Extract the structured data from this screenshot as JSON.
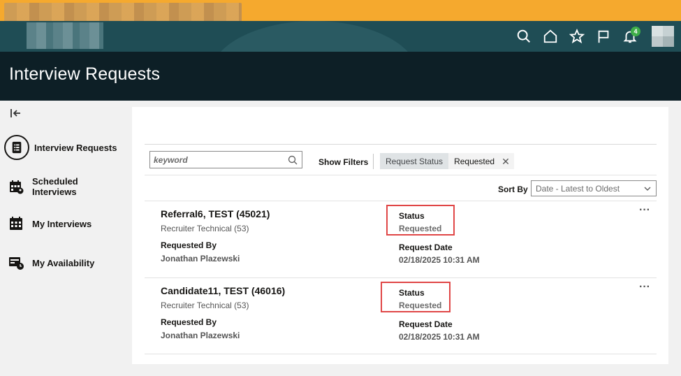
{
  "header": {
    "notification_count": "4",
    "icons": [
      "search-icon",
      "home-icon",
      "star-icon",
      "flag-icon",
      "bell-icon"
    ],
    "colors": {
      "top_strip": "#f5a92e",
      "header_bg": "#1f4d55",
      "title_bg": "#0d1f26",
      "badge": "#3fae49"
    }
  },
  "page": {
    "title": "Interview Requests"
  },
  "sidebar": {
    "items": [
      {
        "label": "Interview Requests",
        "icon": "checklist-icon",
        "active": true
      },
      {
        "label": "Scheduled Interviews",
        "icon": "calendar-group-icon",
        "active": false
      },
      {
        "label": "My Interviews",
        "icon": "calendar-icon",
        "active": false
      },
      {
        "label": "My Availability",
        "icon": "availability-icon",
        "active": false
      }
    ]
  },
  "toolbar": {
    "search_placeholder": "keyword",
    "show_filters_label": "Show Filters",
    "filter_chip": {
      "key": "Request Status",
      "value": "Requested"
    },
    "sort_label": "Sort By",
    "sort_value": "Date - Latest to Oldest"
  },
  "requests": [
    {
      "name": "Referral6, TEST (45021)",
      "role": "Recruiter Technical (53)",
      "requested_by_label": "Requested By",
      "requested_by": "Jonathan Plazewski",
      "status_label": "Status",
      "status": "Requested",
      "request_date_label": "Request Date",
      "request_date": "02/18/2025 10:31 AM"
    },
    {
      "name": "Candidate11, TEST (46016)",
      "role": "Recruiter Technical (53)",
      "requested_by_label": "Requested By",
      "requested_by": "Jonathan Plazewski",
      "status_label": "Status",
      "status": "Requested",
      "request_date_label": "Request Date",
      "request_date": "02/18/2025 10:31 AM"
    }
  ]
}
